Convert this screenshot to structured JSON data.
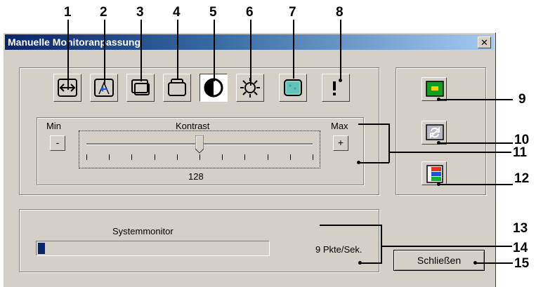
{
  "window": {
    "title": "Manuelle Monitoranpassung",
    "close_glyph": "✕"
  },
  "callouts": [
    "1",
    "2",
    "3",
    "4",
    "5",
    "6",
    "7",
    "8",
    "9",
    "10",
    "11",
    "12",
    "13",
    "14",
    "15"
  ],
  "toolbar": {
    "tools": [
      {
        "name": "horizontal-size-icon"
      },
      {
        "name": "position-icon"
      },
      {
        "name": "vertical-position-icon"
      },
      {
        "name": "size-icon"
      },
      {
        "name": "contrast-icon",
        "active": true
      },
      {
        "name": "brightness-icon"
      },
      {
        "name": "color-icon"
      },
      {
        "name": "advanced-icon"
      }
    ]
  },
  "slider": {
    "min_label": "Min",
    "max_label": "Max",
    "title": "Kontrast",
    "minus": "-",
    "plus": "+",
    "value": "128",
    "fraction": 0.5
  },
  "side_buttons": [
    {
      "name": "apply-icon"
    },
    {
      "name": "refresh-icon"
    },
    {
      "name": "color-bars-icon"
    }
  ],
  "monitor": {
    "label": "Systemmonitor",
    "rate": "9  Pkte/Sek.",
    "progress_fraction": 0.03
  },
  "close_button": "Schließen",
  "colors": {
    "titlebar": "#0a246a",
    "progress": "#0a246a",
    "face": "#d4d0c8"
  }
}
